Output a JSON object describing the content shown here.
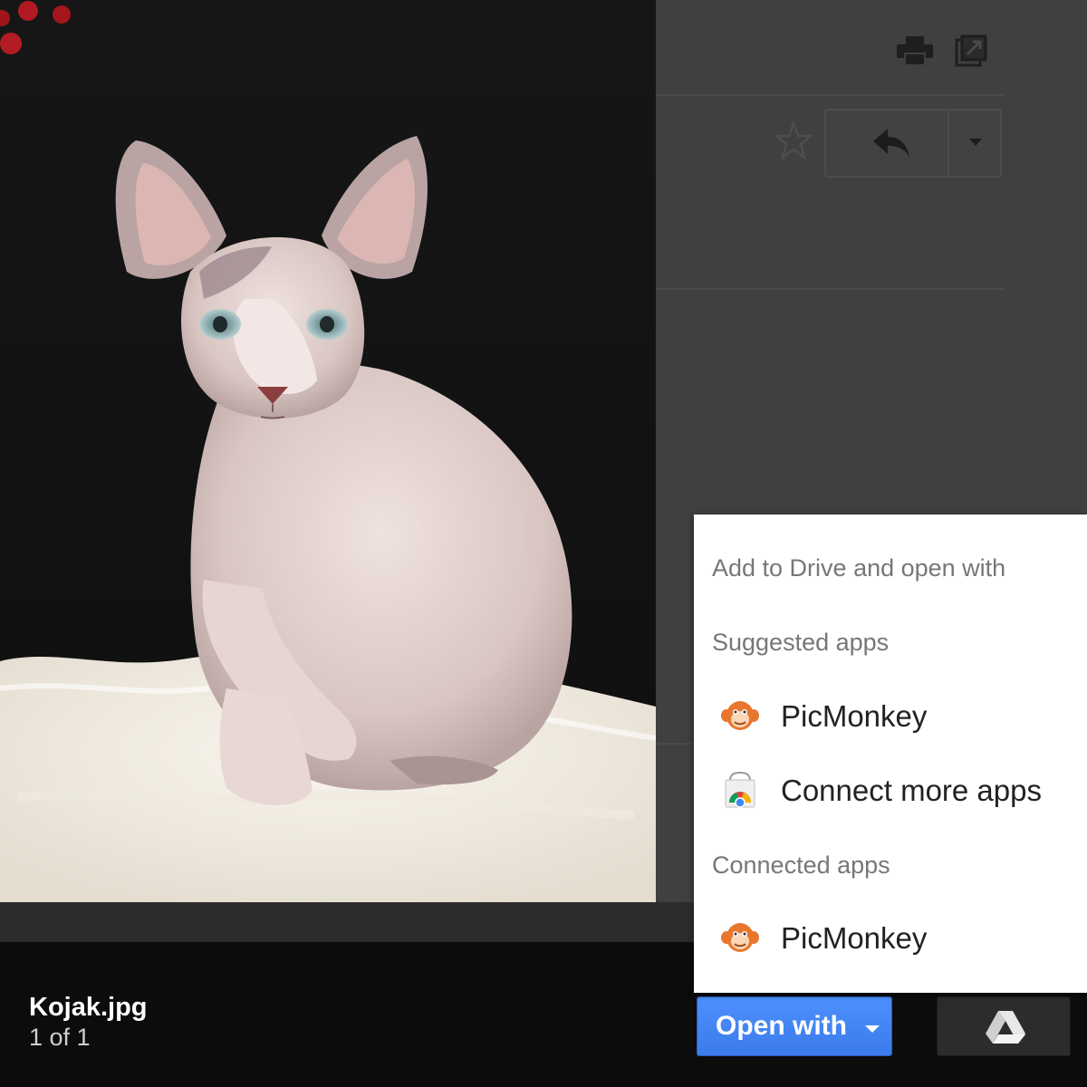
{
  "viewer": {
    "file_name": "Kojak.jpg",
    "file_count": "1 of 1"
  },
  "open_with": {
    "label": "Open with"
  },
  "menu": {
    "header": "Add to Drive and open with",
    "suggested_heading": "Suggested apps",
    "suggested_items": [
      {
        "label": "PicMonkey",
        "icon": "picmonkey-icon"
      },
      {
        "label": "Connect more apps",
        "icon": "chrome-web-store-icon"
      }
    ],
    "connected_heading": "Connected apps",
    "connected_items": [
      {
        "label": "PicMonkey",
        "icon": "picmonkey-icon"
      }
    ]
  },
  "toolbar_icons": [
    "print-icon",
    "popout-icon",
    "star-icon",
    "reply-icon",
    "more-arrow-icon",
    "google-drive-icon"
  ],
  "colors": {
    "accent_blue": "#4d90fe",
    "picmonkey_orange": "#e8772e",
    "menu_bg": "#ffffff",
    "dim_bg": "#3a3a3a"
  }
}
